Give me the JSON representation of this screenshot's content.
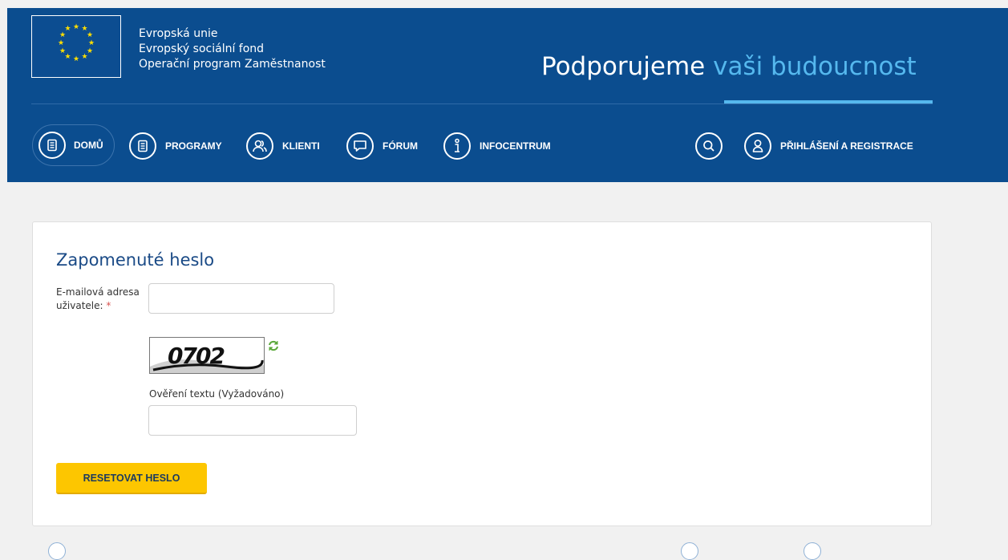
{
  "header": {
    "eu_lines": [
      "Evropská unie",
      "Evropský sociální fond",
      "Operační program Zaměstnanost"
    ],
    "slogan_main": "Podporujeme",
    "slogan_accent": "vaši budoucnost"
  },
  "nav": {
    "home": "DOMŮ",
    "programs": "PROGRAMY",
    "clients": "KLIENTI",
    "forum": "FÓRUM",
    "infocenter": "INFOCENTRUM",
    "login": "PŘIHLÁŠENÍ A REGISTRACE"
  },
  "form": {
    "title": "Zapomenuté heslo",
    "email_label": "E-mailová adresa uživatele:",
    "required_mark": "*",
    "email_value": "",
    "captcha_text": "0702",
    "captcha_label": "Ověření textu (Vyžadováno)",
    "captcha_value": "",
    "reset_button": "RESETOVAT HESLO"
  },
  "colors": {
    "header_bg": "#0b4d8f",
    "accent": "#55b8ee",
    "button": "#fdc600",
    "title": "#1a4a86"
  },
  "icons": [
    "eu-flag",
    "document-icon",
    "users-icon",
    "chat-icon",
    "info-icon",
    "search-icon",
    "user-icon",
    "refresh-icon"
  ]
}
